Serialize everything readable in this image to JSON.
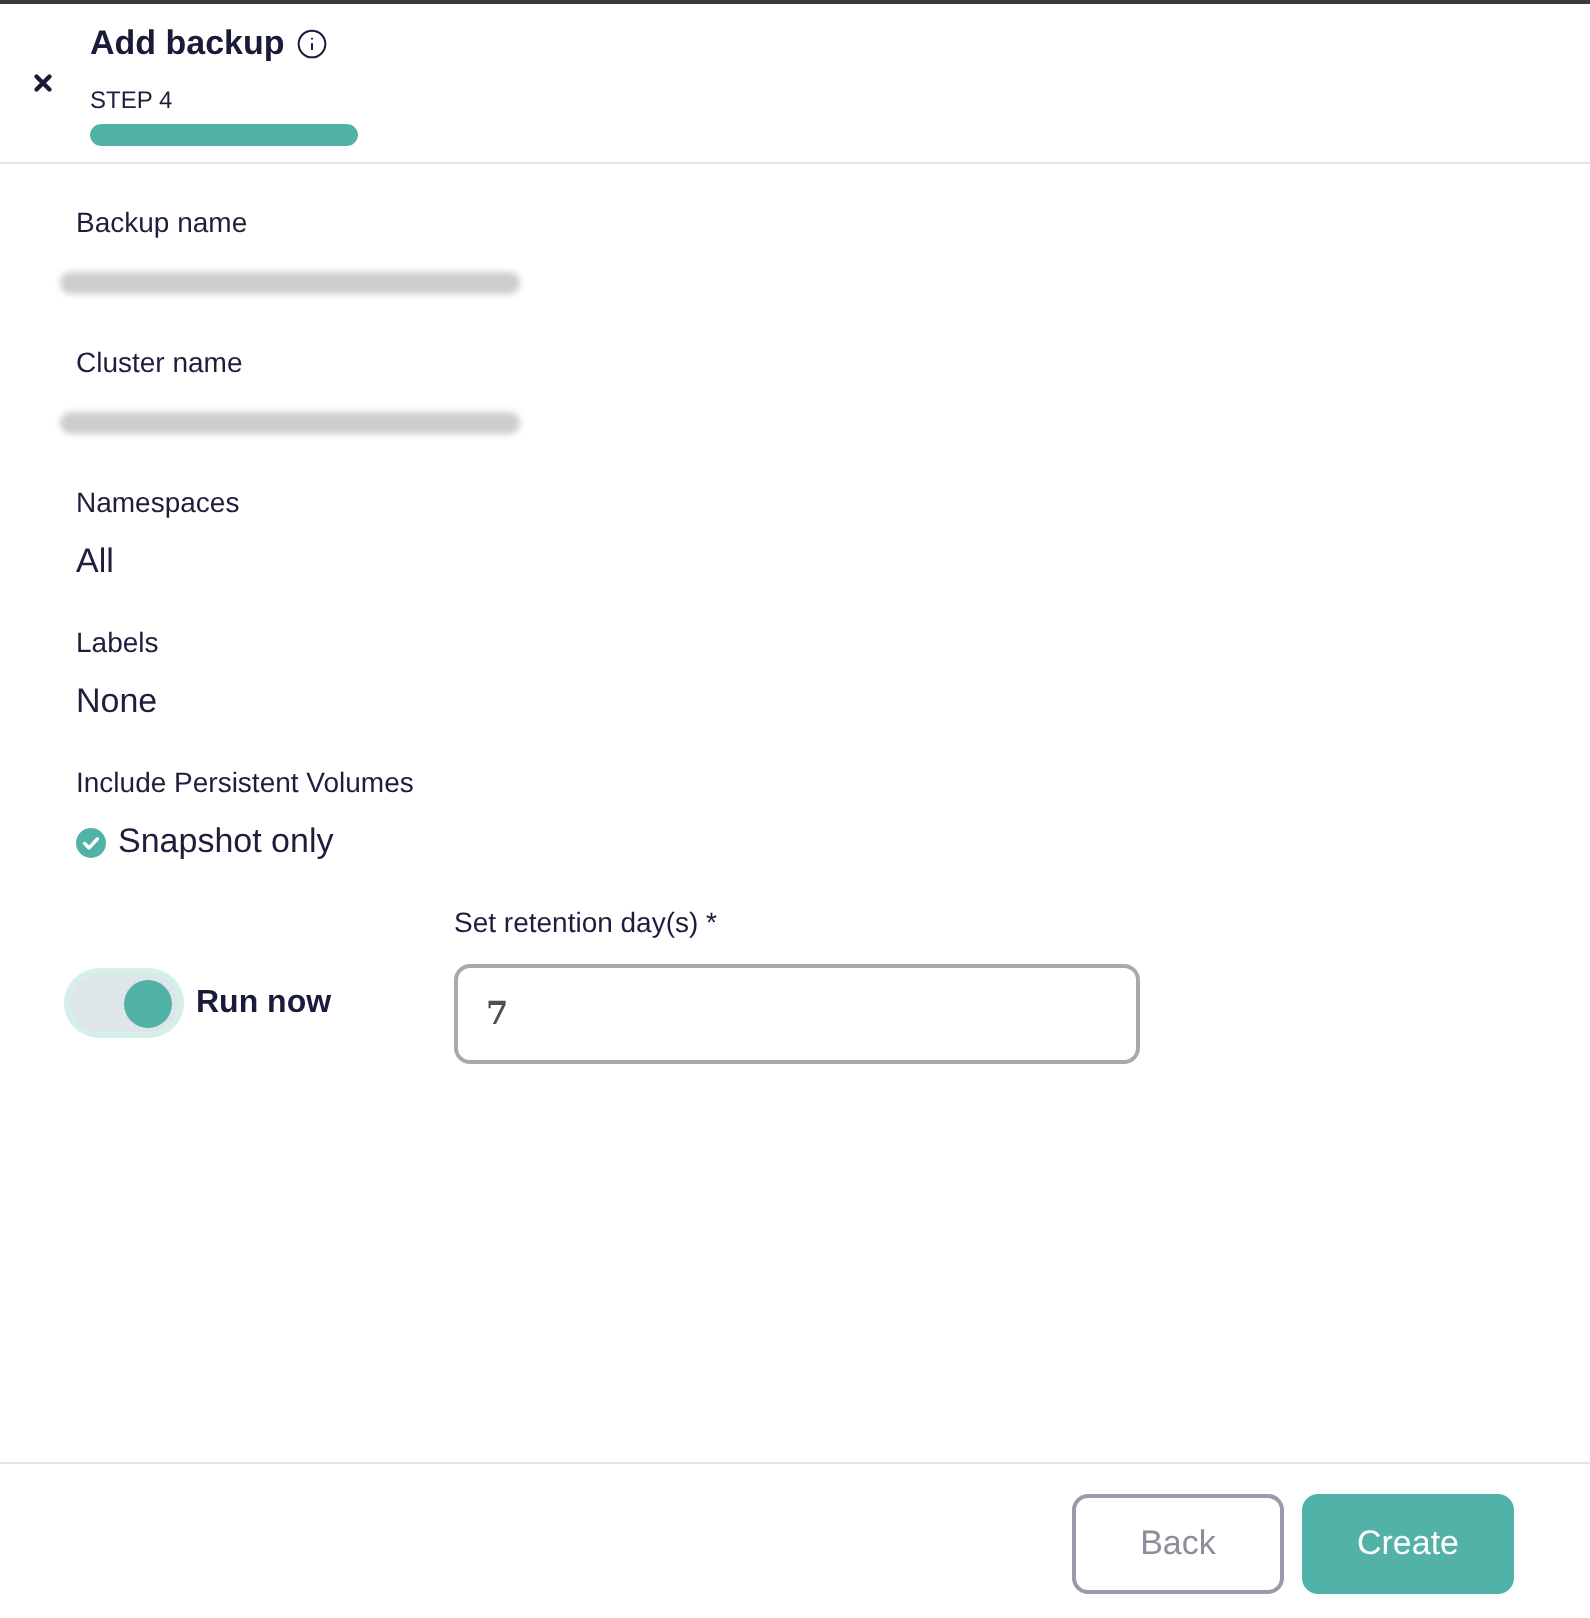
{
  "header": {
    "title": "Add backup",
    "step": "STEP 4",
    "progress": {
      "level": 1
    }
  },
  "summary": [
    {
      "label": "Backup name",
      "kind": "redacted"
    },
    {
      "label": "Cluster name",
      "kind": "redacted"
    },
    {
      "label": "Namespaces",
      "kind": "text",
      "value": "All"
    },
    {
      "label": "Labels",
      "kind": "text",
      "value": "None"
    },
    {
      "label": "Include Persistent Volumes",
      "kind": "check",
      "value": "Snapshot only"
    }
  ],
  "run_now": {
    "label": "Run now",
    "on": true
  },
  "retention": {
    "label": "Set retention day(s) *",
    "value": "7"
  },
  "buttons": [
    {
      "label": "Back",
      "kind": "secondary"
    },
    {
      "label": "Create",
      "kind": "primary"
    }
  ]
}
